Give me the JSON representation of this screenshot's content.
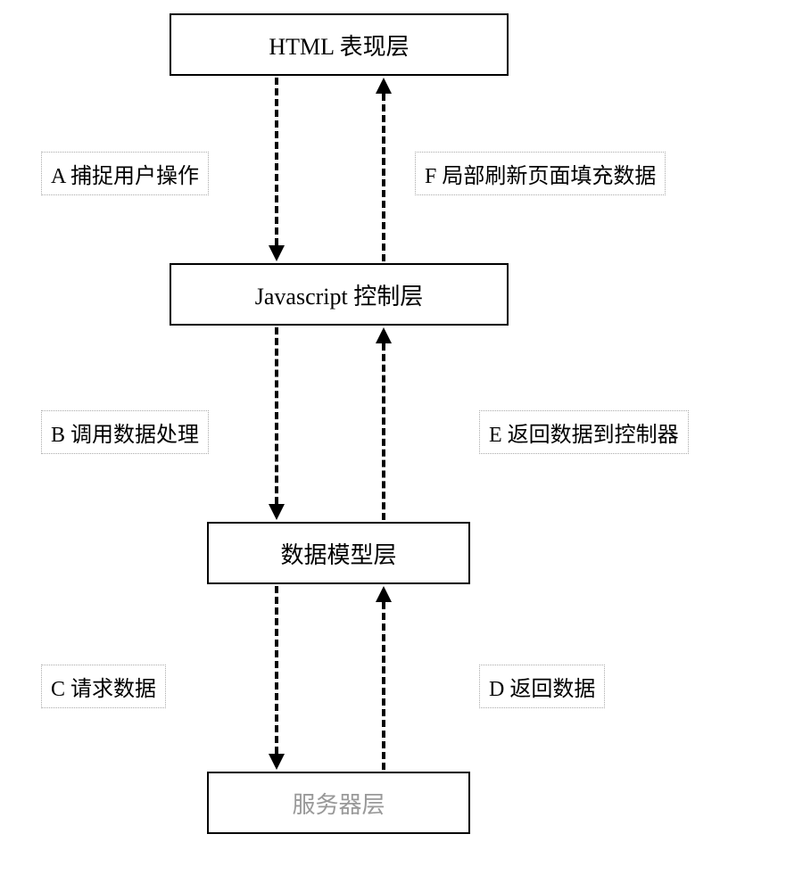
{
  "layers": {
    "html": "HTML 表现层",
    "js": "Javascript 控制层",
    "model": "数据模型层",
    "server": "服务器层"
  },
  "labels": {
    "A": "A 捕捉用户操作",
    "B": "B 调用数据处理",
    "C": "C 请求数据",
    "D": "D 返回数据",
    "E": "E 返回数据到控制器",
    "F": "F 局部刷新页面填充数据"
  }
}
